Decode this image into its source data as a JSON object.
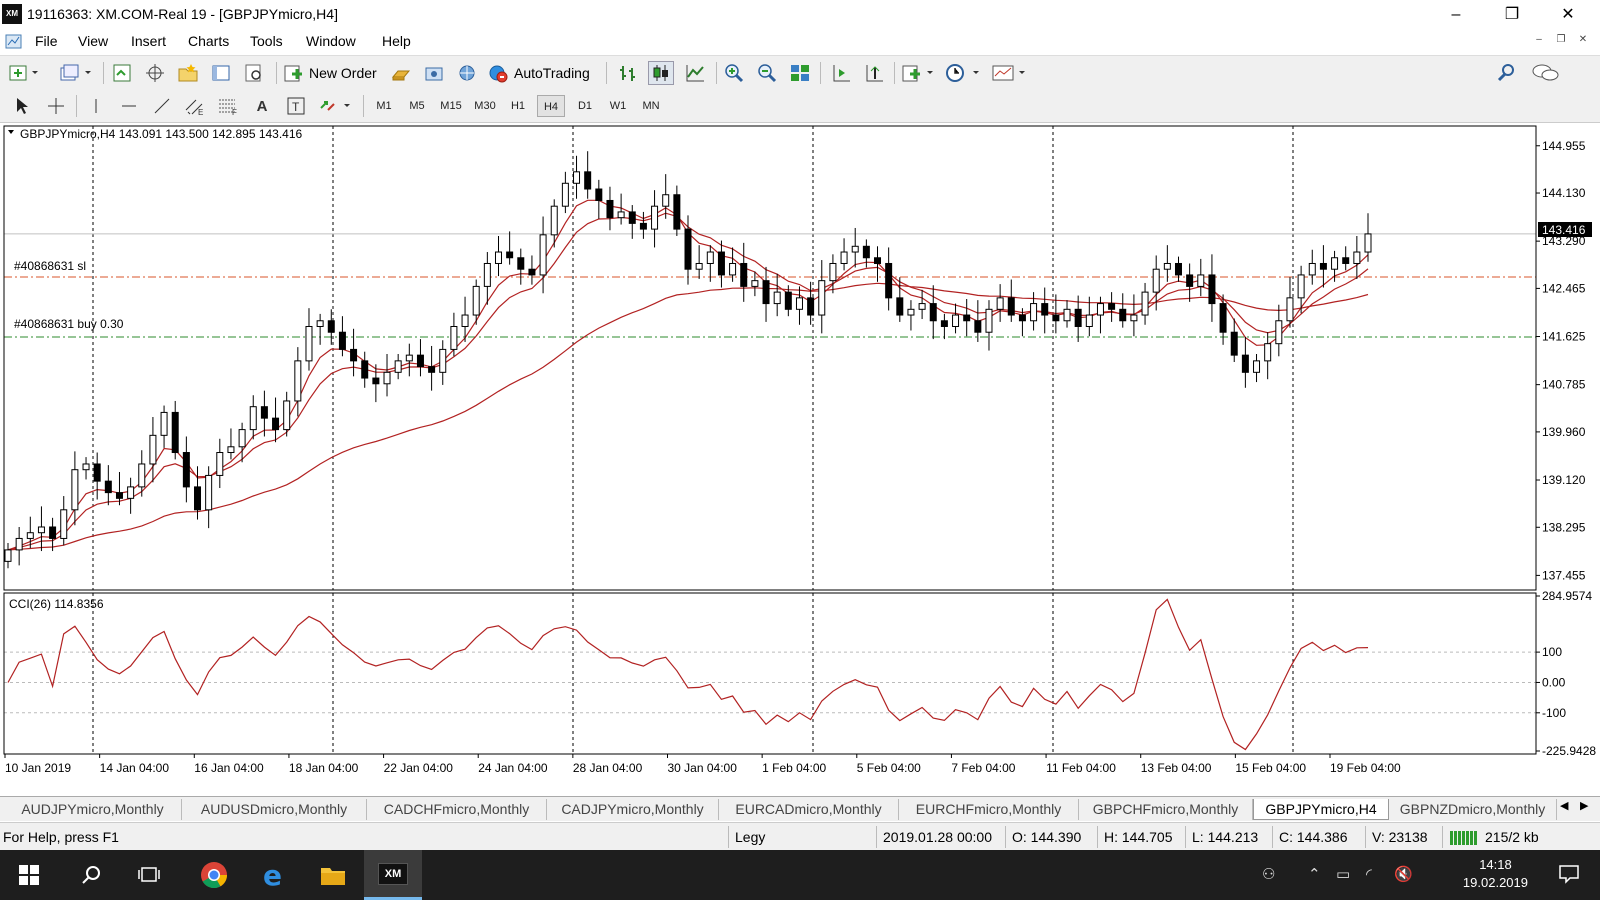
{
  "window": {
    "title": "19116363: XM.COM-Real 19 - [GBPJPYmicro,H4]",
    "logo": "XM",
    "minimize": "–",
    "restore": "❐",
    "close": "✕"
  },
  "menu": [
    "File",
    "View",
    "Insert",
    "Charts",
    "Tools",
    "Window",
    "Help"
  ],
  "toolbar": {
    "new_order": "New Order",
    "auto_trading": "AutoTrading",
    "timeframes": [
      "M1",
      "M5",
      "M15",
      "M30",
      "H1",
      "H4",
      "D1",
      "W1",
      "MN"
    ],
    "active_timeframe": "H4"
  },
  "chart": {
    "header": "GBPJPYmicro,H4  143.091 143.500 142.895 143.416",
    "current_price": "143.416",
    "sl_label": "#40868631 sl",
    "buy_label": "#40868631 buy 0.30",
    "price_ticks": [
      "144.955",
      "144.130",
      "143.290",
      "142.465",
      "141.625",
      "140.785",
      "139.960",
      "139.120",
      "138.295",
      "137.455"
    ],
    "cci_label": "CCI(26) 114.8356",
    "cci_ticks": [
      "284.9574",
      "100",
      "0.00",
      "-100",
      "-225.9428"
    ],
    "time_ticks": [
      "10 Jan 2019",
      "14 Jan 04:00",
      "16 Jan 04:00",
      "18 Jan 04:00",
      "22 Jan 04:00",
      "24 Jan 04:00",
      "28 Jan 04:00",
      "30 Jan 04:00",
      "1 Feb 04:00",
      "5 Feb 04:00",
      "7 Feb 04:00",
      "11 Feb 04:00",
      "13 Feb 04:00",
      "15 Feb 04:00",
      "19 Feb 04:00"
    ]
  },
  "chart_data": {
    "type": "candlestick",
    "symbol": "GBPJPYmicro",
    "timeframe": "H4",
    "ylim": [
      137.2,
      145.3
    ],
    "close_series": [
      137.9,
      138.1,
      138.2,
      138.3,
      138.1,
      138.6,
      139.3,
      139.4,
      139.1,
      138.9,
      138.8,
      139.0,
      139.4,
      139.9,
      140.3,
      139.6,
      139.0,
      138.6,
      139.2,
      139.6,
      139.7,
      140.0,
      140.4,
      140.2,
      140.0,
      140.5,
      141.2,
      141.8,
      141.9,
      141.7,
      141.4,
      141.2,
      140.9,
      140.8,
      141.0,
      141.2,
      141.3,
      141.1,
      141.0,
      141.4,
      141.8,
      142.0,
      142.5,
      142.9,
      143.1,
      143.0,
      142.8,
      142.7,
      143.4,
      143.9,
      144.3,
      144.5,
      144.2,
      144.0,
      143.7,
      143.8,
      143.6,
      143.5,
      143.9,
      144.1,
      143.5,
      142.8,
      142.9,
      143.1,
      142.7,
      142.9,
      142.5,
      142.6,
      142.2,
      142.4,
      142.1,
      142.3,
      142.0,
      142.6,
      142.9,
      143.1,
      143.2,
      143.0,
      142.9,
      142.3,
      142.0,
      142.1,
      142.2,
      141.9,
      141.8,
      142.0,
      141.9,
      141.7,
      142.1,
      142.3,
      142.0,
      141.9,
      142.2,
      142.0,
      141.9,
      142.1,
      141.8,
      142.0,
      142.2,
      142.1,
      141.9,
      142.0,
      142.4,
      142.8,
      142.9,
      142.7,
      142.5,
      142.7,
      142.2,
      141.7,
      141.3,
      141.0,
      141.2,
      141.5,
      141.9,
      142.3,
      142.7,
      142.9,
      142.8,
      143.0,
      142.9,
      143.1,
      143.416
    ],
    "cci": {
      "name": "CCI(26)",
      "last": 114.8356,
      "ylim": [
        -225.9428,
        284.9574
      ]
    }
  },
  "tabs": [
    "AUDJPYmicro,Monthly",
    "AUDUSDmicro,Monthly",
    "CADCHFmicro,Monthly",
    "CADJPYmicro,Monthly",
    "EURCADmicro,Monthly",
    "EURCHFmicro,Monthly",
    "GBPCHFmicro,Monthly",
    "GBPJPYmicro,H4",
    "GBPNZDmicro,Monthly"
  ],
  "active_tab": "GBPJPYmicro,H4",
  "status": {
    "help": "For Help, press F1",
    "profile": "Legy",
    "datetime": "2019.01.28 00:00",
    "open": "O: 144.390",
    "high": "H: 144.705",
    "low": "L: 144.213",
    "close": "C: 144.386",
    "volume": "V: 23138",
    "traffic": "215/2 kb"
  },
  "taskbar": {
    "time": "14:18",
    "date": "19.02.2019"
  }
}
